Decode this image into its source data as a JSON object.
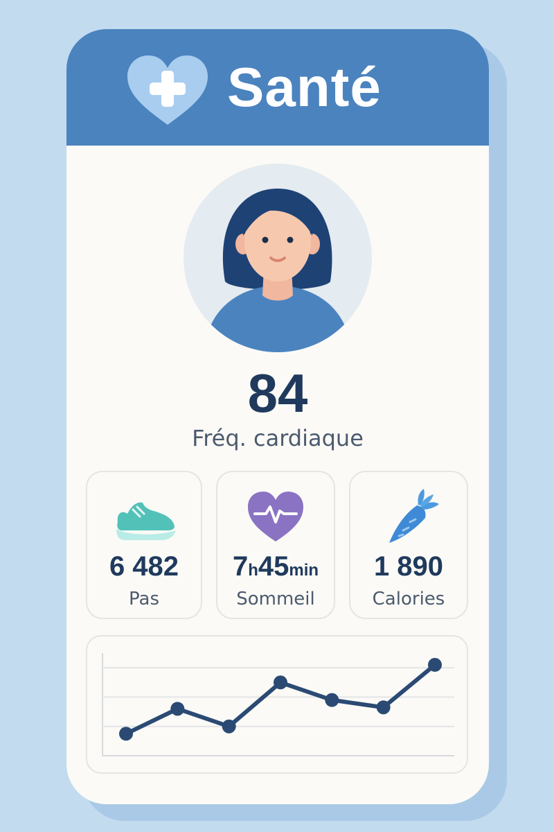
{
  "header": {
    "title": "Santé",
    "logo_icon": "heart-plus-icon"
  },
  "profile": {
    "avatar_icon": "woman-avatar-icon"
  },
  "heart_rate": {
    "value": "84",
    "label": "Fréq. cardiaque"
  },
  "stats": [
    {
      "icon": "sneaker-icon",
      "value": "6 482",
      "label": "Pas"
    },
    {
      "icon": "heartbeat-icon",
      "value_hours": "7",
      "unit_hours": "h",
      "value_minutes": "45",
      "unit_minutes": "min",
      "label": "Sommeil"
    },
    {
      "icon": "carrot-icon",
      "value": "1 890",
      "label": "Calories"
    }
  ],
  "colors": {
    "header": "#4b83bf",
    "card": "#fbfaf6",
    "background": "#c2dbef",
    "text_dark": "#1f3a5d",
    "line": "#2b4a73"
  },
  "chart_data": {
    "type": "line",
    "series": [
      {
        "values": [
          1.5,
          3.2,
          2.0,
          5.0,
          3.8,
          3.3,
          6.2
        ]
      }
    ],
    "ylim": [
      0,
      7
    ],
    "grid": true,
    "legend": "none"
  }
}
